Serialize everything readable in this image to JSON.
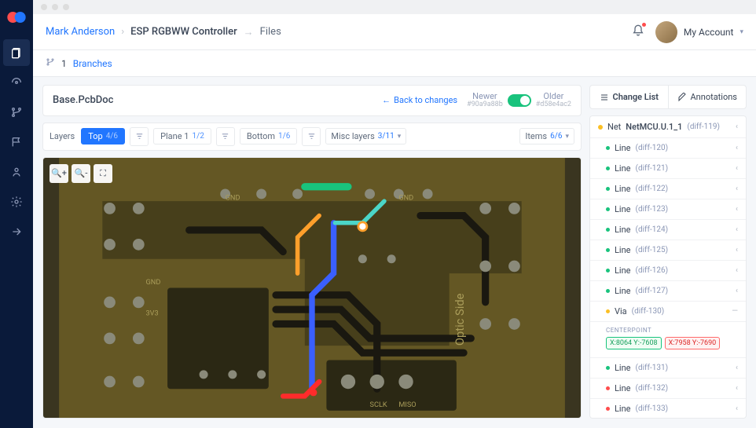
{
  "breadcrumb": {
    "user": "Mark Anderson",
    "project": "ESP RGBWW Controller",
    "page": "Files"
  },
  "account": {
    "label": "My Account"
  },
  "subbar": {
    "count": "1",
    "label": "Branches"
  },
  "doc": {
    "title": "Base.PcbDoc",
    "back": "Back to changes",
    "newer": {
      "label": "Newer",
      "hash": "#90a9a88b"
    },
    "older": {
      "label": "Older",
      "hash": "#d58e4ac2"
    }
  },
  "layers": {
    "label": "Layers",
    "top": {
      "name": "Top",
      "count": "4/6"
    },
    "plane": {
      "name": "Plane 1",
      "count": "1/2"
    },
    "bottom": {
      "name": "Bottom",
      "count": "1/6"
    },
    "misc": {
      "name": "Misc layers",
      "count": "3/11"
    },
    "items": {
      "name": "Items",
      "count": "6/6"
    }
  },
  "tabs": {
    "change": "Change List",
    "annot": "Annotations"
  },
  "net": {
    "prefix": "Net",
    "name": "NetMCU.U.1_1",
    "diff": "(diff-119)"
  },
  "diffs": [
    {
      "type": "Line",
      "id": "(diff-120)",
      "color": "g"
    },
    {
      "type": "Line",
      "id": "(diff-121)",
      "color": "g"
    },
    {
      "type": "Line",
      "id": "(diff-122)",
      "color": "g"
    },
    {
      "type": "Line",
      "id": "(diff-123)",
      "color": "g"
    },
    {
      "type": "Line",
      "id": "(diff-124)",
      "color": "g"
    },
    {
      "type": "Line",
      "id": "(diff-125)",
      "color": "g"
    },
    {
      "type": "Line",
      "id": "(diff-126)",
      "color": "g"
    },
    {
      "type": "Line",
      "id": "(diff-127)",
      "color": "g"
    },
    {
      "type": "Via",
      "id": "(diff-130)",
      "color": "y",
      "expanded": true
    },
    {
      "type": "Line",
      "id": "(diff-131)",
      "color": "g"
    },
    {
      "type": "Line",
      "id": "(diff-132)",
      "color": "r"
    },
    {
      "type": "Line",
      "id": "(diff-133)",
      "color": "r"
    }
  ],
  "detail": {
    "label": "CENTERPOINT",
    "green": "X:8064 Y:-7608",
    "red": "X:7958 Y:-7690"
  },
  "pcb": {
    "text_gnd": "GND",
    "text_3v3": "3V3",
    "text_optic": "Optic Side",
    "text_sclk": "SCLK",
    "text_miso": "MISO"
  }
}
